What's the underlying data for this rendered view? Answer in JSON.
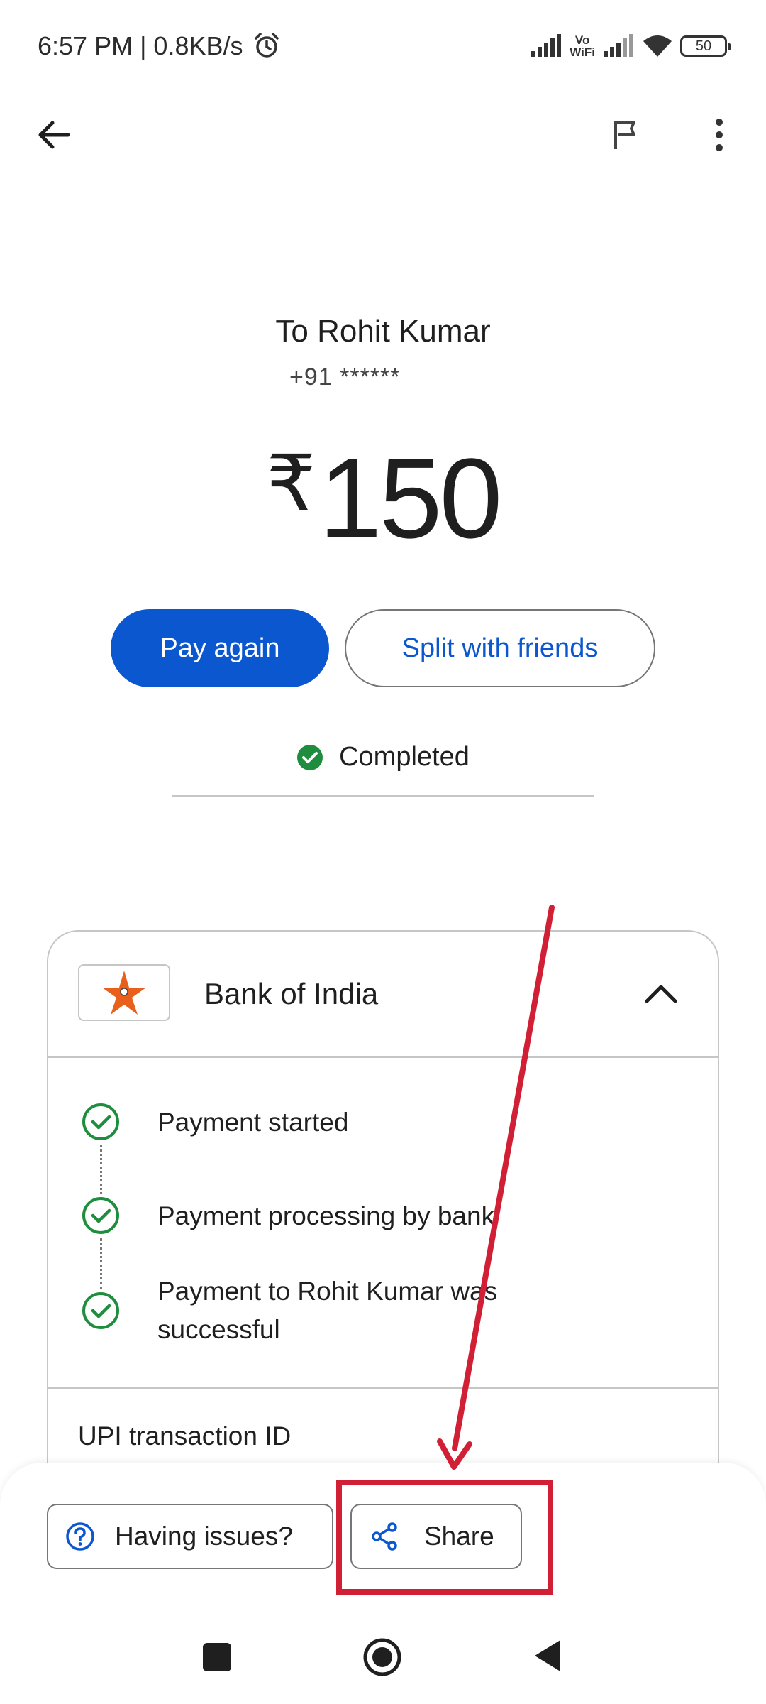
{
  "status_bar": {
    "time_speed": "6:57 PM | 0.8KB/s",
    "vowifi_line1": "Vo",
    "vowifi_line2": "WiFi",
    "battery": "50"
  },
  "transaction": {
    "recipient": "To Rohit Kumar",
    "phone": "+91 ******",
    "currency": "₹",
    "amount": "150",
    "status": "Completed"
  },
  "actions": {
    "pay_again": "Pay again",
    "split": "Split with friends"
  },
  "details": {
    "bank_name": "Bank of India",
    "steps": [
      {
        "label": "Payment started"
      },
      {
        "label": "Payment processing by bank"
      },
      {
        "label": "Payment to Rohit Kumar was successful"
      }
    ],
    "upi_label": "UPI transaction ID"
  },
  "bottom": {
    "issues": "Having issues?",
    "share": "Share"
  },
  "colors": {
    "primary": "#0b57d0",
    "success": "#1e8e3e",
    "annotation": "#d11f35"
  }
}
